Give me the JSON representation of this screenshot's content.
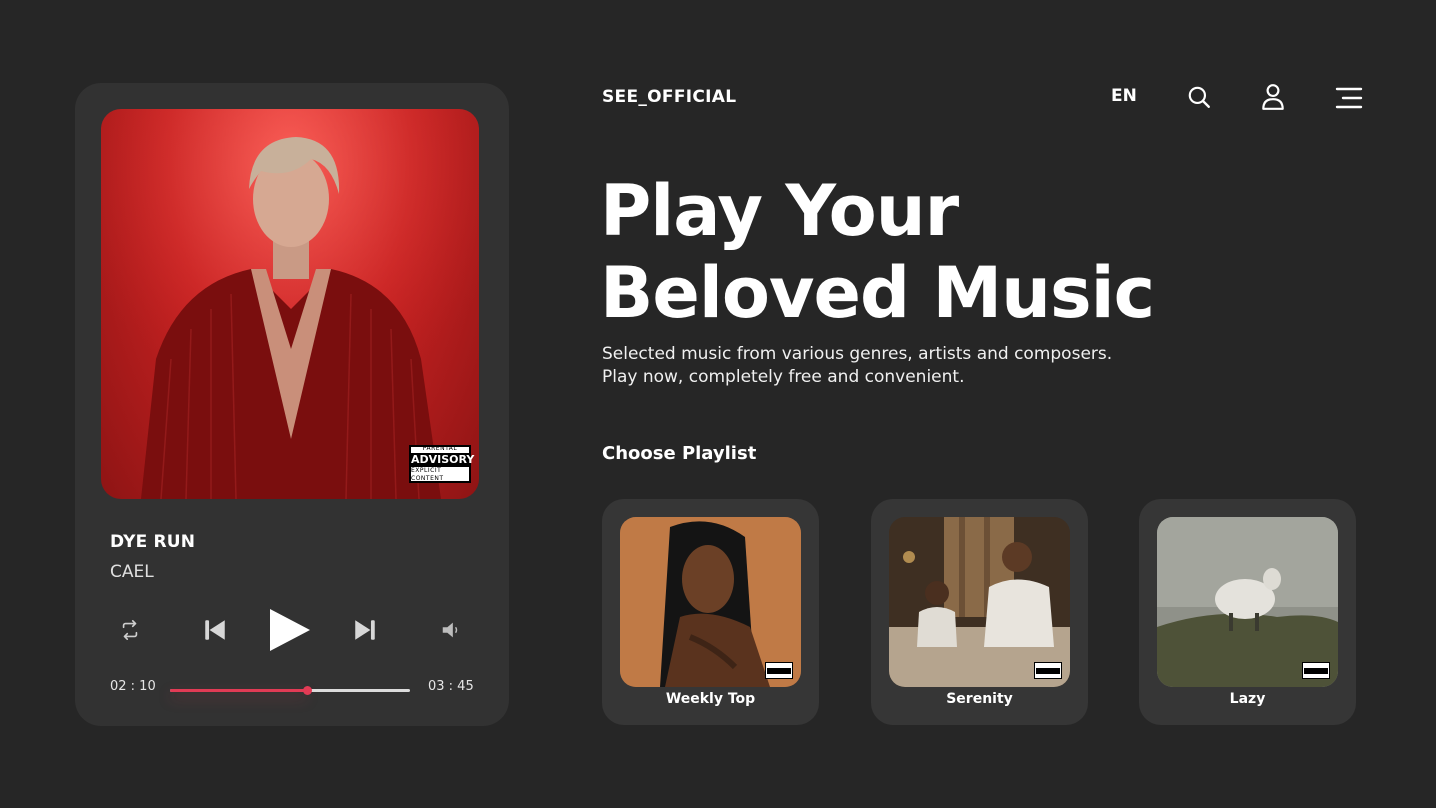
{
  "header": {
    "brand": "SEE_OFFICIAL",
    "language": "EN",
    "icons": [
      "search-icon",
      "user-icon",
      "menu-icon"
    ]
  },
  "hero": {
    "line1": "Play Your",
    "line2": "Beloved Music",
    "subtitle_line1": "Selected music from various genres, artists and composers.",
    "subtitle_line2": "Play now, completely free and convenient."
  },
  "player": {
    "title": "DYE RUN",
    "artist": "CAEL",
    "current_time": "02 : 10",
    "total_time": "03 : 45",
    "progress": 0.57,
    "advisory": {
      "line1": "PARENTAL",
      "line2": "ADVISORY",
      "line3": "EXPLICIT CONTENT"
    },
    "controls": [
      "repeat-icon",
      "previous-icon",
      "play-icon",
      "next-icon",
      "volume-icon"
    ]
  },
  "playlists": {
    "heading": "Choose Playlist",
    "items": [
      {
        "label": "Weekly Top"
      },
      {
        "label": "Serenity"
      },
      {
        "label": "Lazy"
      }
    ]
  },
  "colors": {
    "background": "#262626",
    "card": "#323232",
    "accent": "#e23b55"
  }
}
